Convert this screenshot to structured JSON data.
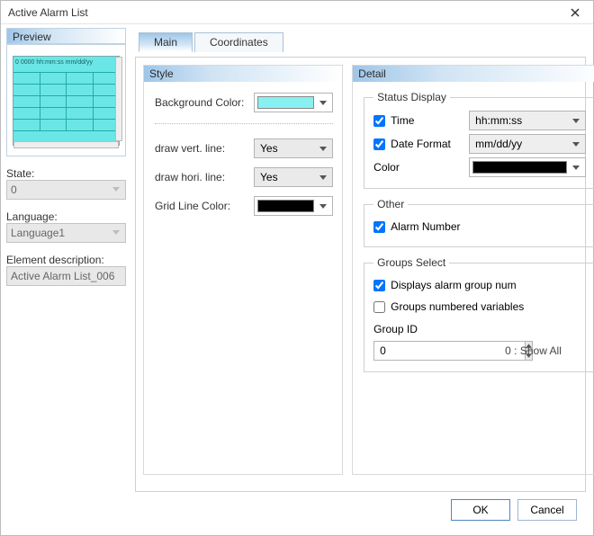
{
  "window": {
    "title": "Active Alarm List"
  },
  "sidebar": {
    "preview_label": "Preview",
    "preview_header_strip": "0 0000 hh:mm:ss mm/dd/yy",
    "state_label": "State:",
    "state_value": "0",
    "language_label": "Language:",
    "language_value": "Language1",
    "elemdesc_label": "Element description:",
    "elemdesc_value": "Active Alarm List_006"
  },
  "tabs": {
    "main": "Main",
    "coordinates": "Coordinates"
  },
  "style": {
    "section_title": "Style",
    "bgcolor_label": "Background Color:",
    "bgcolor_swatch": "#88f0f0",
    "vert_label": "draw vert. line:",
    "vert_value": "Yes",
    "hori_label": "draw hori. line:",
    "hori_value": "Yes",
    "gridcolor_label": "Grid Line Color:",
    "gridcolor_swatch": "#000000"
  },
  "detail": {
    "section_title": "Detail",
    "status_group": "Status Display",
    "time_label": "Time",
    "time_checked": true,
    "time_format": "hh:mm:ss",
    "date_label": "Date Format",
    "date_checked": true,
    "date_format": "mm/dd/yy",
    "color_label": "Color",
    "color_swatch": "#000000",
    "other_group": "Other",
    "alarm_number_label": "Alarm Number",
    "alarm_number_checked": true,
    "groups_select_group": "Groups Select",
    "disp_group_num_label": "Displays alarm group num",
    "disp_group_num_checked": true,
    "grp_var_label": "Groups numbered variables",
    "grp_var_checked": false,
    "group_id_label": "Group ID",
    "group_id_value": "0",
    "group_id_hint": "0 : Show All"
  },
  "footer": {
    "ok": "OK",
    "cancel": "Cancel"
  }
}
